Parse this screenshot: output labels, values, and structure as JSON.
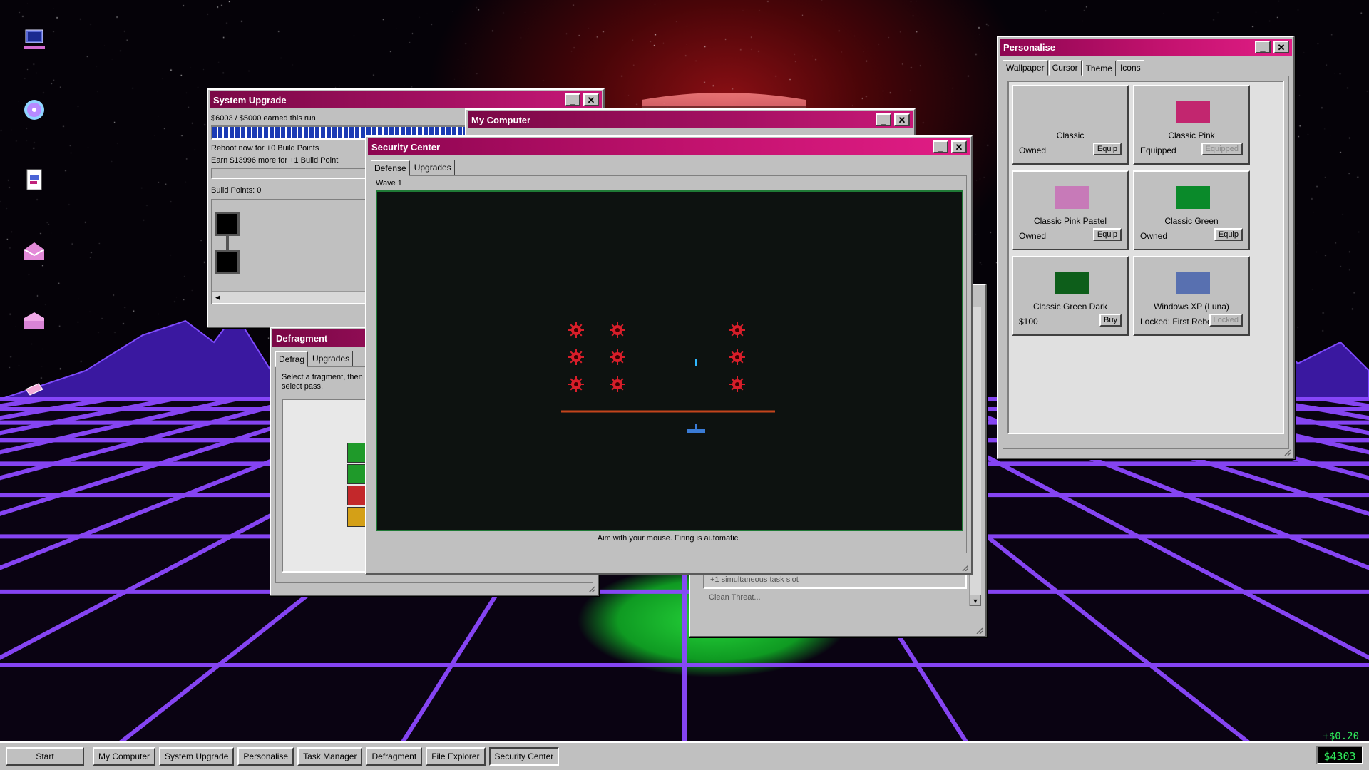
{
  "desktop": {
    "icons": [
      "computer-icon",
      "disc-icon",
      "file-explorer-icon",
      "mail-icon",
      "folder-icon",
      "eraser-icon"
    ]
  },
  "system_upgrade": {
    "title": "System Upgrade",
    "earned_text": "$6003 / $5000 earned this run",
    "progress": 1.0,
    "reboot_text": "Reboot now for +0 Build Points",
    "earn_more_text": "Earn $13996 more for +1 Build Point",
    "build_points": "Build Points: 0"
  },
  "my_computer": {
    "title": "My Computer"
  },
  "task_manager": {
    "row1": "+1 simultaneous task slot",
    "row2": "Clean Threat..."
  },
  "defragment": {
    "title": "Defragment",
    "tabs": [
      "Defrag",
      "Upgrades"
    ],
    "instructions": "Select a fragment, then select pass.",
    "block_colors": [
      "#1f9a2a",
      "#1f9a2a",
      "#c3282b",
      "#d4a017"
    ]
  },
  "security_center": {
    "title": "Security Center",
    "tabs": [
      "Defense",
      "Upgrades"
    ],
    "wave": "Wave 1",
    "hint": "Aim with your mouse. Firing is automatic.",
    "game_colors": {
      "bg": "#0d1210",
      "border": "#1f7a36",
      "enemy": "#d81e2a",
      "shield": "#c2441c",
      "player": "#3a7bd5",
      "bullet": "#2fb8ff"
    }
  },
  "personalise": {
    "title": "Personalise",
    "tabs": [
      "Wallpaper",
      "Cursor",
      "Theme",
      "Icons"
    ],
    "themes": [
      {
        "name": "Classic",
        "status": "Owned",
        "button": "Equip",
        "color": "#c0c0c0",
        "disabled": false
      },
      {
        "name": "Classic Pink",
        "status": "Equipped",
        "button": "Equipped",
        "color": "#c2266f",
        "disabled": true
      },
      {
        "name": "Classic Pink Pastel",
        "status": "Owned",
        "button": "Equip",
        "color": "#c77ab8",
        "disabled": false
      },
      {
        "name": "Classic Green",
        "status": "Owned",
        "button": "Equip",
        "color": "#0a8a2a",
        "disabled": false
      },
      {
        "name": "Classic Green Dark",
        "status": "$100",
        "button": "Buy",
        "color": "#0d5e1a",
        "disabled": false
      },
      {
        "name": "Windows XP (Luna)",
        "status": "Locked: First Reboot",
        "button": "Locked",
        "color": "#5870b0",
        "disabled": true
      }
    ]
  },
  "taskbar": {
    "start": "Start",
    "items": [
      "My Computer",
      "System Upgrade",
      "Personalise",
      "Task Manager",
      "Defragment",
      "File Explorer",
      "Security Center"
    ],
    "active": "Security Center",
    "income": "+$0.20",
    "money": "$4303"
  }
}
